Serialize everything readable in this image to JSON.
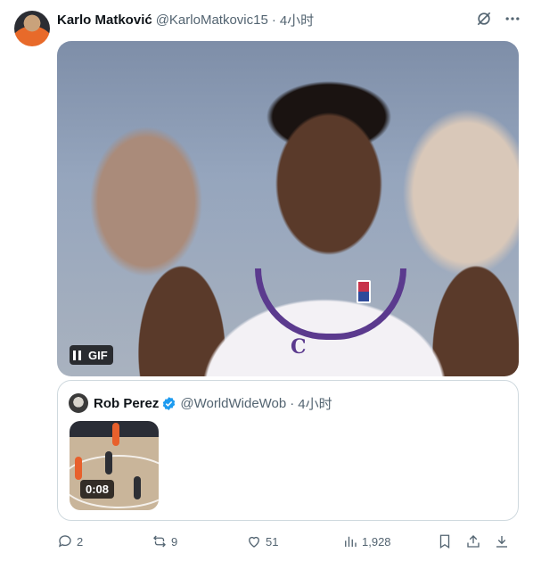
{
  "tweet": {
    "author_name": "Karlo Matković",
    "author_handle": "@KarloMatkovic15",
    "separator": "·",
    "time": "4小时",
    "media": {
      "badge_label": "GIF"
    }
  },
  "quote": {
    "author_name": "Rob Perez",
    "author_handle": "@WorldWideWob",
    "separator": "·",
    "time": "4小时",
    "video_duration": "0:08"
  },
  "actions": {
    "replies": "2",
    "reposts": "9",
    "likes": "51",
    "views": "1,928"
  },
  "icons": {
    "grok": "grok-icon",
    "more": "more-icon",
    "reply": "reply-icon",
    "repost": "repost-icon",
    "like": "heart-icon",
    "views": "views-icon",
    "bookmark": "bookmark-icon",
    "share": "share-icon",
    "download": "download-icon"
  },
  "colors": {
    "text": "#0f1419",
    "secondary": "#536471",
    "verified": "#1d9bf0",
    "border": "#cfd9de"
  }
}
